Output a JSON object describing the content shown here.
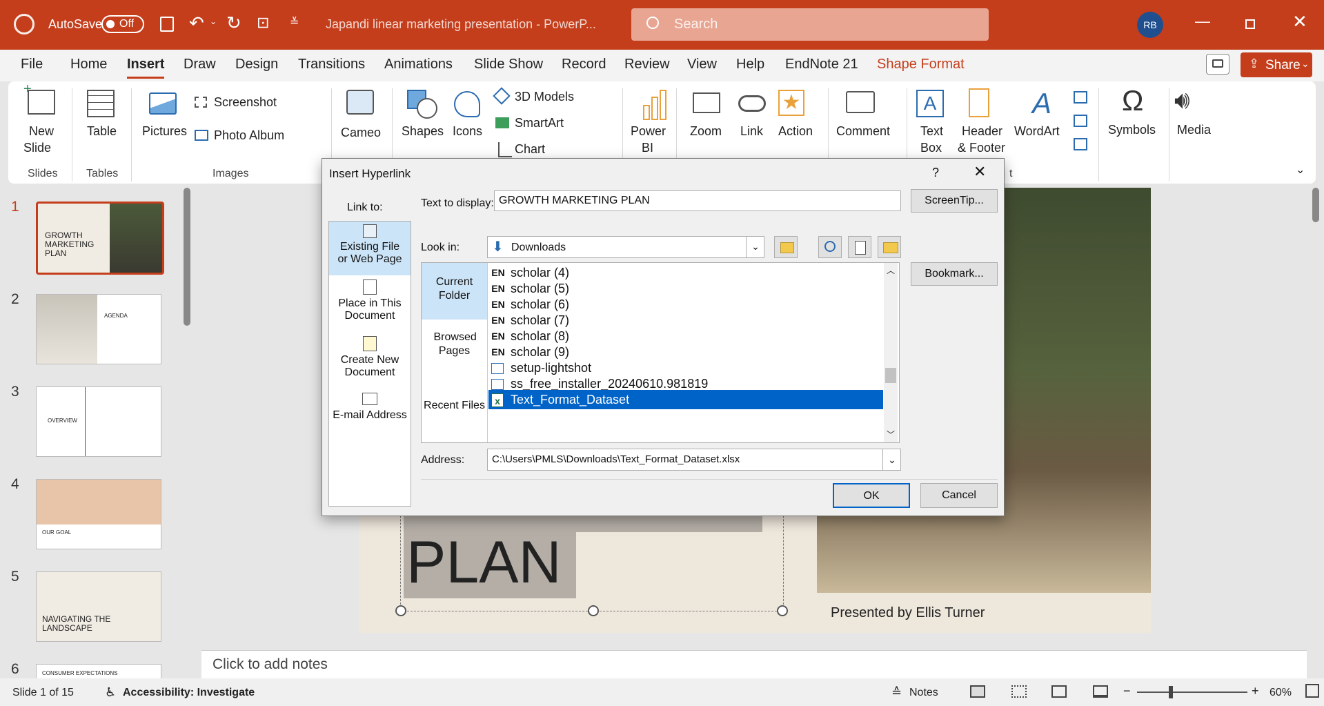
{
  "titlebar": {
    "autosave_label": "AutoSave",
    "autosave_state": "Off",
    "doc_title": "Japandi linear marketing presentation  -  PowerP...",
    "search_placeholder": "Search",
    "avatar": "RB"
  },
  "menu": {
    "tabs": [
      "File",
      "Home",
      "Insert",
      "Draw",
      "Design",
      "Transitions",
      "Animations",
      "Slide Show",
      "Record",
      "Review",
      "View",
      "Help",
      "EndNote 21",
      "Shape Format"
    ],
    "share": "Share"
  },
  "ribbon": {
    "new_slide": "New",
    "new_slide2": "Slide",
    "table": "Table",
    "pictures": "Pictures",
    "screenshot": "Screenshot",
    "photo_album": "Photo Album",
    "cameo": "Cameo",
    "shapes": "Shapes",
    "icons": "Icons",
    "models3d": "3D Models",
    "smartart": "SmartArt",
    "chart": "Chart",
    "powerbi": "Power",
    "powerbi2": "BI",
    "zoom": "Zoom",
    "link": "Link",
    "action": "Action",
    "comment": "Comment",
    "textbox": "Text",
    "textbox2": "Box",
    "header": "Header",
    "header2": "& Footer",
    "wordart": "WordArt",
    "symbols": "Symbols",
    "media": "Media",
    "groups": {
      "slides": "Slides",
      "tables": "Tables",
      "images": "Images",
      "t": "t"
    }
  },
  "thumbnails": [
    {
      "num": "1",
      "text": "GROWTH MARKETING PLAN",
      "sub": "Presented by Ellis Turner"
    },
    {
      "num": "2",
      "text": "AGENDA"
    },
    {
      "num": "3",
      "text": "OVERVIEW"
    },
    {
      "num": "4",
      "text": "OUR GOAL"
    },
    {
      "num": "5",
      "text": "NAVIGATING THE LANDSCAPE"
    },
    {
      "num": "6",
      "text": "CONSUMER EXPECTATIONS"
    }
  ],
  "slide": {
    "title_line1": "MARKETING",
    "title_line2": "PLAN",
    "presenter": "Presented by Ellis Turner"
  },
  "notes_placeholder": "Click to add notes",
  "statusbar": {
    "slide_count": "Slide 1 of 15",
    "accessibility": "Accessibility: Investigate",
    "notes": "Notes",
    "zoom": "60%"
  },
  "dialog": {
    "title": "Insert Hyperlink",
    "help": "?",
    "link_to": "Link to:",
    "link_items": [
      "Existing File or Web Page",
      "Place in This Document",
      "Create New Document",
      "E-mail Address"
    ],
    "text_to_display_label": "Text to display:",
    "text_to_display": "GROWTH MARKETING PLAN",
    "screentip": "ScreenTip...",
    "look_in_label": "Look in:",
    "look_in": "Downloads",
    "bookmark": "Bookmark...",
    "side_tabs": [
      "Current Folder",
      "Browsed Pages",
      "Recent Files"
    ],
    "files": [
      {
        "icon": "EN",
        "name": "scholar (4)"
      },
      {
        "icon": "EN",
        "name": "scholar (5)"
      },
      {
        "icon": "EN",
        "name": "scholar (6)"
      },
      {
        "icon": "EN",
        "name": "scholar (7)"
      },
      {
        "icon": "EN",
        "name": "scholar (8)"
      },
      {
        "icon": "EN",
        "name": "scholar (9)"
      },
      {
        "icon": "app",
        "name": "setup-lightshot"
      },
      {
        "icon": "app",
        "name": "ss_free_installer_20240610.981819"
      },
      {
        "icon": "xlsx",
        "name": "Text_Format_Dataset"
      }
    ],
    "address_label": "Address:",
    "address": "C:\\Users\\PMLS\\Downloads\\Text_Format_Dataset.xlsx",
    "ok": "OK",
    "cancel": "Cancel"
  },
  "colors": {
    "accent": "#c43e1c",
    "selection": "#0063c8",
    "link_sel": "#cce4f7"
  }
}
